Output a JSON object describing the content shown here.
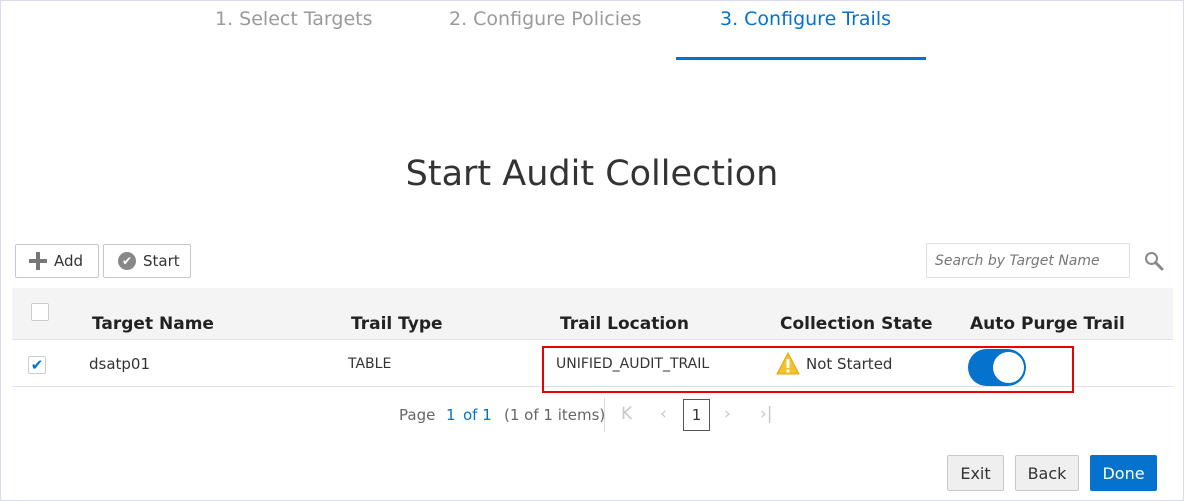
{
  "train": {
    "steps": [
      {
        "label": "1. Select Targets",
        "state": "visited"
      },
      {
        "label": "2. Configure Policies",
        "state": "visited"
      },
      {
        "label": "3. Configure Trails",
        "state": "active"
      }
    ]
  },
  "page_title": "Start Audit Collection",
  "toolbar": {
    "add_label": "Add",
    "start_label": "Start",
    "search_placeholder": "Search by Target Name"
  },
  "table": {
    "columns": [
      "Target Name",
      "Trail Type",
      "Trail Location",
      "Collection State",
      "Auto Purge Trail"
    ],
    "rows": [
      {
        "selected": true,
        "target_name": "dsatp01",
        "trail_type": "TABLE",
        "trail_location": "UNIFIED_AUDIT_TRAIL",
        "collection_state": "Not Started",
        "collection_state_icon": "warning-icon",
        "auto_purge": true
      }
    ]
  },
  "pagination": {
    "page_label": "Page",
    "page": "1",
    "of_label": "of 1",
    "items_label": "(1 of 1 items)",
    "current_page_button": "1"
  },
  "footer": {
    "exit_label": "Exit",
    "back_label": "Back",
    "done_label": "Done"
  },
  "colors": {
    "accent": "#0572ce",
    "highlight_box": "#ee0000",
    "warning": "#f2c230"
  }
}
